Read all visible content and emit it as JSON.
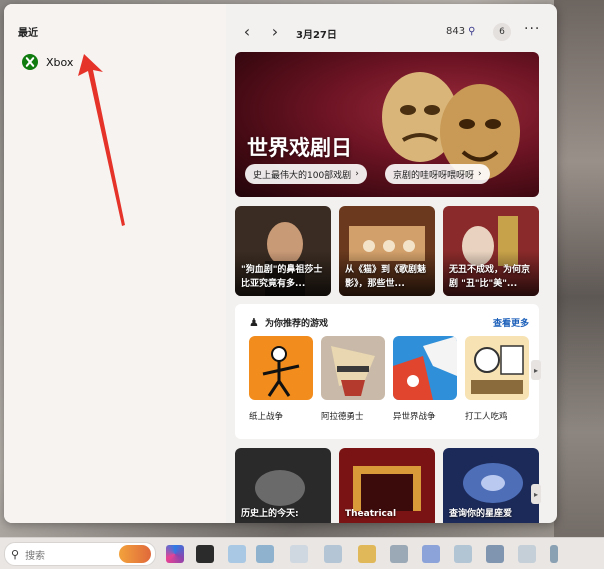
{
  "recent": {
    "title": "最近",
    "items": [
      {
        "label": "Xbox"
      }
    ]
  },
  "topbar": {
    "prev_icon": "chevron-left-icon",
    "next_icon": "chevron-right-icon",
    "date": "3月27日",
    "points": "843",
    "badge_count": "6",
    "more_icon": "more-icon"
  },
  "hero": {
    "title": "世界戏剧日",
    "chips": [
      {
        "label": "史上最伟大的100部戏剧"
      },
      {
        "label": "京剧的哇呀呀喂呀呀"
      }
    ]
  },
  "news": [
    {
      "text": "\"狗血剧\"的鼻祖莎士比亚究竟有多..."
    },
    {
      "text": "从《猫》到《歌剧魅影》，那些世..."
    },
    {
      "text": "无丑不成戏，为何京剧 \"丑\"比\"美\"..."
    }
  ],
  "games": {
    "title": "为你推荐的游戏",
    "more_label": "查看更多",
    "items": [
      {
        "name": "纸上战争"
      },
      {
        "name": "阿拉德勇士"
      },
      {
        "name": "异世界战争"
      },
      {
        "name": "打工人吃鸡"
      }
    ]
  },
  "bottom_cards": [
    {
      "text": "历史上的今天:"
    },
    {
      "text": "Theatrical"
    },
    {
      "text": "查询你的星座爱"
    }
  ],
  "taskbar": {
    "search_placeholder": "搜索"
  },
  "colors": {
    "accent_link": "#1b5fb9",
    "xbox_green": "#107c10",
    "hero_red": "#6e1424",
    "arrow_red": "#e5332a"
  }
}
